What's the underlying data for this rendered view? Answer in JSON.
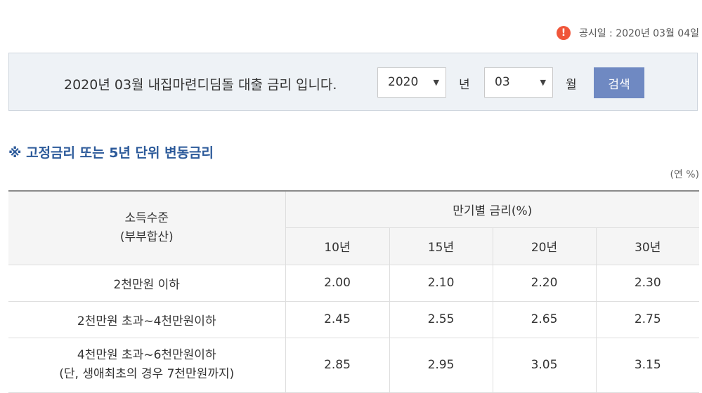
{
  "notice": {
    "icon": "alert-icon",
    "text": "공시일 : 2020년 03월 04일"
  },
  "search": {
    "caption": "2020년 03월 내집마련디딤돌 대출 금리 입니다.",
    "year_value": "2020",
    "year_unit": "년",
    "month_value": "03",
    "month_unit": "월",
    "button_label": "검색"
  },
  "section": {
    "title": "※ 고정금리 또는 5년 단위 변동금리",
    "unit_note": "(연 %)"
  },
  "table": {
    "income_header_line1": "소득수준",
    "income_header_line2": "(부부합산)",
    "rate_header": "만기별 금리(%)",
    "terms": [
      "10년",
      "15년",
      "20년",
      "30년"
    ],
    "rows": [
      {
        "label": "2천만원 이하",
        "label2": "",
        "values": [
          "2.00",
          "2.10",
          "2.20",
          "2.30"
        ]
      },
      {
        "label": "2천만원 초과~4천만원이하",
        "label2": "",
        "values": [
          "2.45",
          "2.55",
          "2.65",
          "2.75"
        ]
      },
      {
        "label": "4천만원 초과~6천만원이하",
        "label2": "(단, 생애최초의 경우 7천만원까지)",
        "values": [
          "2.85",
          "2.95",
          "3.05",
          "3.15"
        ]
      }
    ]
  }
}
